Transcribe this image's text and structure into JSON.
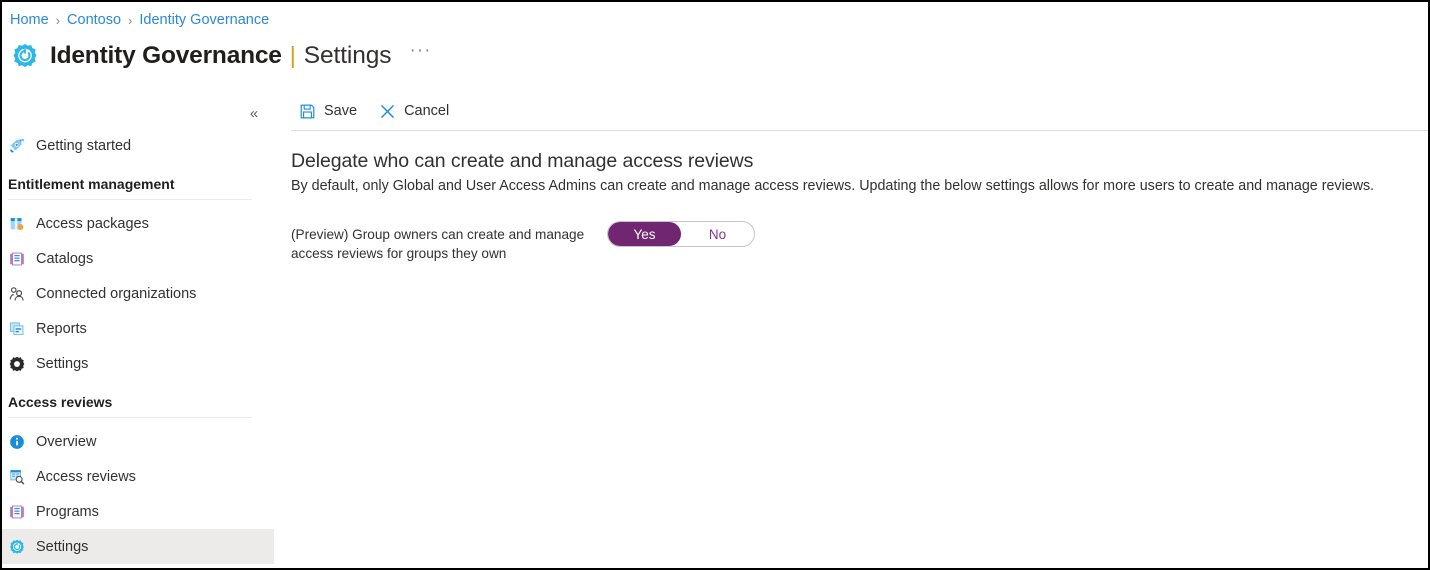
{
  "breadcrumb": {
    "separator": "›",
    "items": [
      {
        "label": "Home"
      },
      {
        "label": "Contoso"
      },
      {
        "label": "Identity Governance"
      }
    ]
  },
  "header": {
    "icon": "gear-icon",
    "title": "Identity Governance",
    "separator": "|",
    "subtitle": "Settings",
    "more_label": "···",
    "accent_color": "#2bb8e8"
  },
  "sidebar": {
    "collapse_label": "«",
    "top_items": [
      {
        "label": "Getting started",
        "icon": "rocket-icon",
        "selected": false
      }
    ],
    "sections": [
      {
        "title": "Entitlement management",
        "items": [
          {
            "label": "Access packages",
            "icon": "access-package-icon",
            "selected": false
          },
          {
            "label": "Catalogs",
            "icon": "catalog-book-icon",
            "selected": false
          },
          {
            "label": "Connected organizations",
            "icon": "people-icon",
            "selected": false
          },
          {
            "label": "Reports",
            "icon": "reports-icon",
            "selected": false
          },
          {
            "label": "Settings",
            "icon": "gear-dark-icon",
            "selected": false
          }
        ]
      },
      {
        "title": "Access reviews",
        "items": [
          {
            "label": "Overview",
            "icon": "info-icon",
            "selected": false
          },
          {
            "label": "Access reviews",
            "icon": "review-search-icon",
            "selected": false
          },
          {
            "label": "Programs",
            "icon": "catalog-book-icon",
            "selected": false
          },
          {
            "label": "Settings",
            "icon": "gear-icon",
            "selected": true
          }
        ]
      }
    ]
  },
  "command_bar": {
    "buttons": [
      {
        "label": "Save",
        "icon": "save-icon"
      },
      {
        "label": "Cancel",
        "icon": "close-x-icon"
      }
    ]
  },
  "main": {
    "heading": "Delegate who can create and manage access reviews",
    "description": "By default, only Global and User Access Admins can create and manage access reviews. Updating the below settings allows for more users to create and manage reviews.",
    "settings": [
      {
        "label": "(Preview) Group owners can create and manage access reviews for groups they own",
        "toggle": {
          "options": [
            "Yes",
            "No"
          ],
          "value": "Yes",
          "active_color": "#702670",
          "inactive_text_color": "#7a3a8c"
        }
      }
    ]
  }
}
